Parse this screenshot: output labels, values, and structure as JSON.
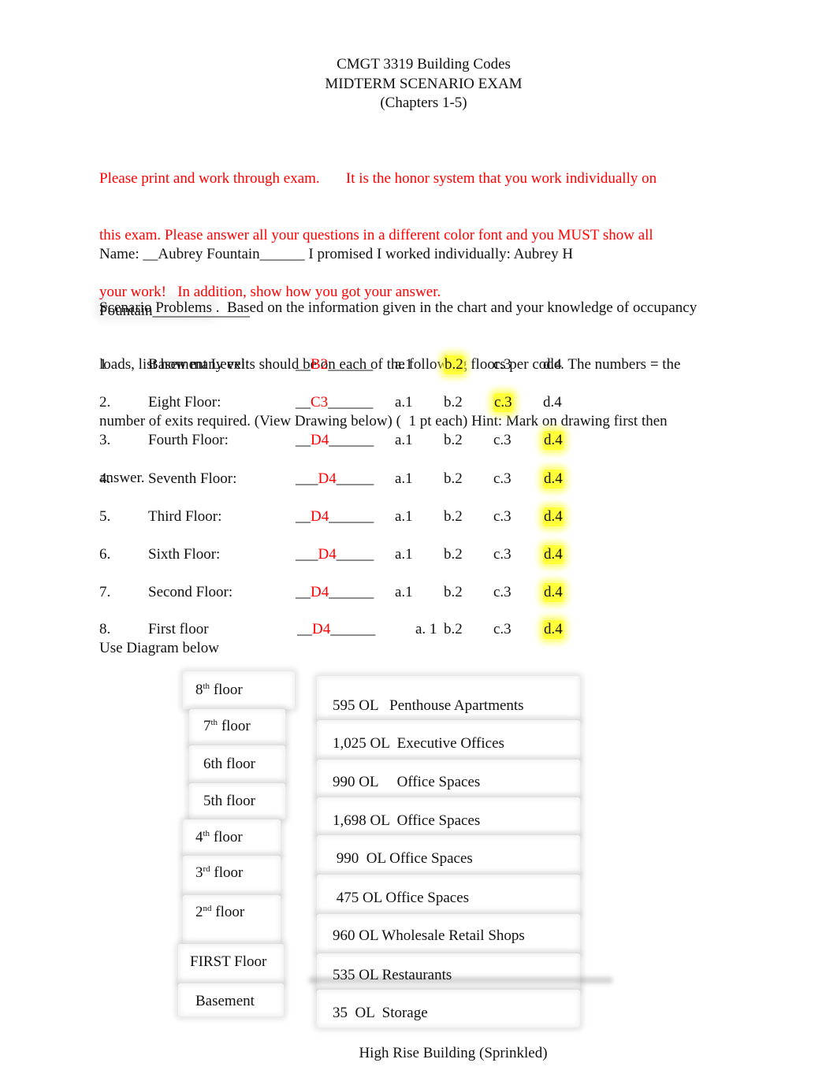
{
  "header": {
    "course": "CMGT 3319 Building Codes",
    "exam": "MIDTERM SCENARIO EXAM",
    "chapters": "(Chapters 1-5)"
  },
  "instructions": {
    "line1": "Please print and work through exam.       It is the honor system that you work individually on",
    "line2": "this exam. Please answer all your questions in a different color font and you MUST show all",
    "line3": "your work!   In addition, show how you got your answer."
  },
  "name_block": {
    "line1": "Name: __Aubrey Fountain______ I promised I worked individually: Aubrey H",
    "line2": "Fountain_____________"
  },
  "scenario": {
    "label": "Scenario Problems",
    "text_line1": " .  Based on the information given in the chart and your knowledge of occupancy",
    "text_line2": "loads, list how many exits should be on each of the following floors per code. The numbers = the",
    "text_line3": "number of exits required. (View Drawing below) (  1 pt each) Hint: Mark on drawing first then",
    "text_line4": "answer."
  },
  "highlight_color": "#ffff3a",
  "answer_color": "#ff0000",
  "questions": [
    {
      "num": "1",
      "label": "Basement Level:",
      "pre": "__",
      "answer": "B2",
      "post": "______",
      "options": [
        "a.1",
        "b.2",
        "c.3",
        "d.4"
      ],
      "selected": 1
    },
    {
      "num": "2.",
      "label": "Eight Floor:",
      "pre": "__",
      "answer": "C3",
      "post": "______",
      "options": [
        "a.1",
        "b.2",
        "c.3",
        "d.4"
      ],
      "selected": 2
    },
    {
      "num": "3.",
      "label": "Fourth Floor:",
      "pre": "__",
      "answer": "D4",
      "post": "______",
      "options": [
        "a.1",
        "b.2",
        "c.3",
        "d.4"
      ],
      "selected": 3
    },
    {
      "num": "4.",
      "label": "Seventh Floor:",
      "pre": "___",
      "answer": "D4",
      "post": "_____",
      "options": [
        "a.1",
        "b.2",
        "c.3",
        "d.4"
      ],
      "selected": 3
    },
    {
      "num": "5.",
      "label": "Third Floor:",
      "pre": "__",
      "answer": "D4",
      "post": "______",
      "options": [
        "a.1",
        "b.2",
        "c.3",
        "d.4"
      ],
      "selected": 3
    },
    {
      "num": "6.",
      "label": "Sixth Floor:",
      "pre": "___",
      "answer": "D4",
      "post": "_____",
      "options": [
        "a.1",
        "b.2",
        "c.3",
        "d.4"
      ],
      "selected": 3
    },
    {
      "num": "7.",
      "label": "Second Floor:",
      "pre": "__",
      "answer": "D4",
      "post": "______",
      "options": [
        "a.1",
        "b.2",
        "c.3",
        "d.4"
      ],
      "selected": 3
    },
    {
      "num": "8.",
      "label": "First floor",
      "pre": "__",
      "answer": "D4",
      "post": "______",
      "options": [
        "a. 1",
        "b.2",
        "c.3",
        "d.4"
      ],
      "selected": 3
    }
  ],
  "diagram_intro": "Use Diagram below",
  "diagram": {
    "floors": [
      {
        "num": "8",
        "sup": "th",
        "rest": " floor"
      },
      {
        "num": "7",
        "sup": "th",
        "rest": " floor"
      },
      {
        "num": "6th floor",
        "sup": "",
        "rest": ""
      },
      {
        "num": "5th floor",
        "sup": "",
        "rest": ""
      },
      {
        "num": "4",
        "sup": "th",
        "rest": " floor"
      },
      {
        "num": "3",
        "sup": "rd",
        "rest": " floor"
      },
      {
        "num": "2",
        "sup": "nd",
        "rest": " floor"
      },
      {
        "num": "FIRST Floor",
        "sup": "",
        "rest": ""
      },
      {
        "num": "Basement",
        "sup": "",
        "rest": ""
      }
    ],
    "loads": [
      "595 OL   Penthouse Apartments",
      "1,025 OL  Executive Offices",
      "990 OL     Office Spaces",
      "1,698 OL  Office Spaces",
      " 990  OL Office Spaces",
      " 475 OL Office Spaces",
      "960 OL Wholesale Retail Shops",
      "535 OL Restaurants",
      "35  OL  Storage"
    ],
    "caption": "High Rise Building (Sprinkled)"
  }
}
